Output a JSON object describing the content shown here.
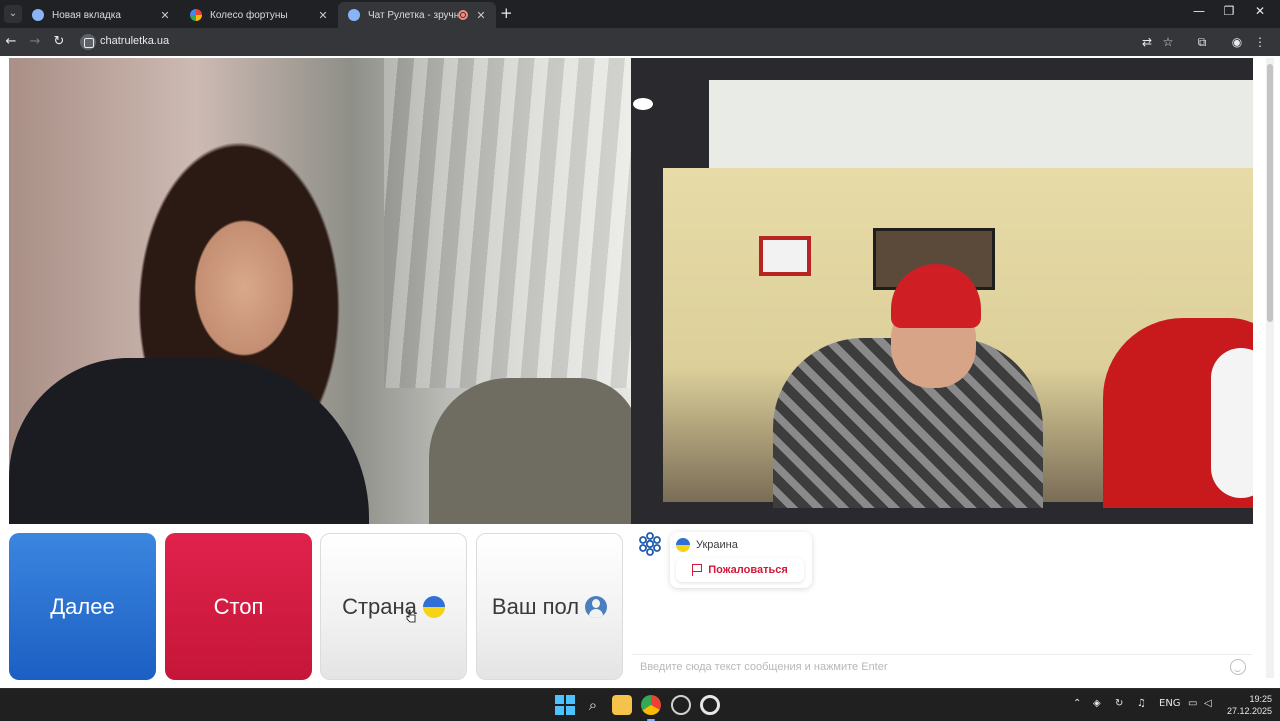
{
  "browser": {
    "tabs": [
      {
        "title": "Новая вкладка",
        "active": false
      },
      {
        "title": "Колесо фортуны",
        "active": false
      },
      {
        "title": "Чат Рулетка - зручний та б",
        "active": true
      }
    ],
    "url": "chatruletka.ua",
    "new_tab_symbol": "+",
    "window_controls": [
      "—",
      "❐",
      "✕"
    ]
  },
  "controls": {
    "next_label": "Далее",
    "stop_label": "Стоп",
    "country_label": "Страна",
    "gender_label": "Ваш пол"
  },
  "chat": {
    "partner_country": "Украина",
    "report_label": "Пожаловаться",
    "input_placeholder": "Введите сюда текст сообщения и нажмите Enter"
  },
  "taskbar": {
    "language": "ENG",
    "time": "19:25",
    "date": "27.12.2025"
  },
  "colors": {
    "next_button": "#1c5fc3",
    "stop_button": "#c51638",
    "report_text": "#d2183d",
    "ua_blue": "#2f6fd6",
    "ua_yellow": "#f5d417"
  }
}
